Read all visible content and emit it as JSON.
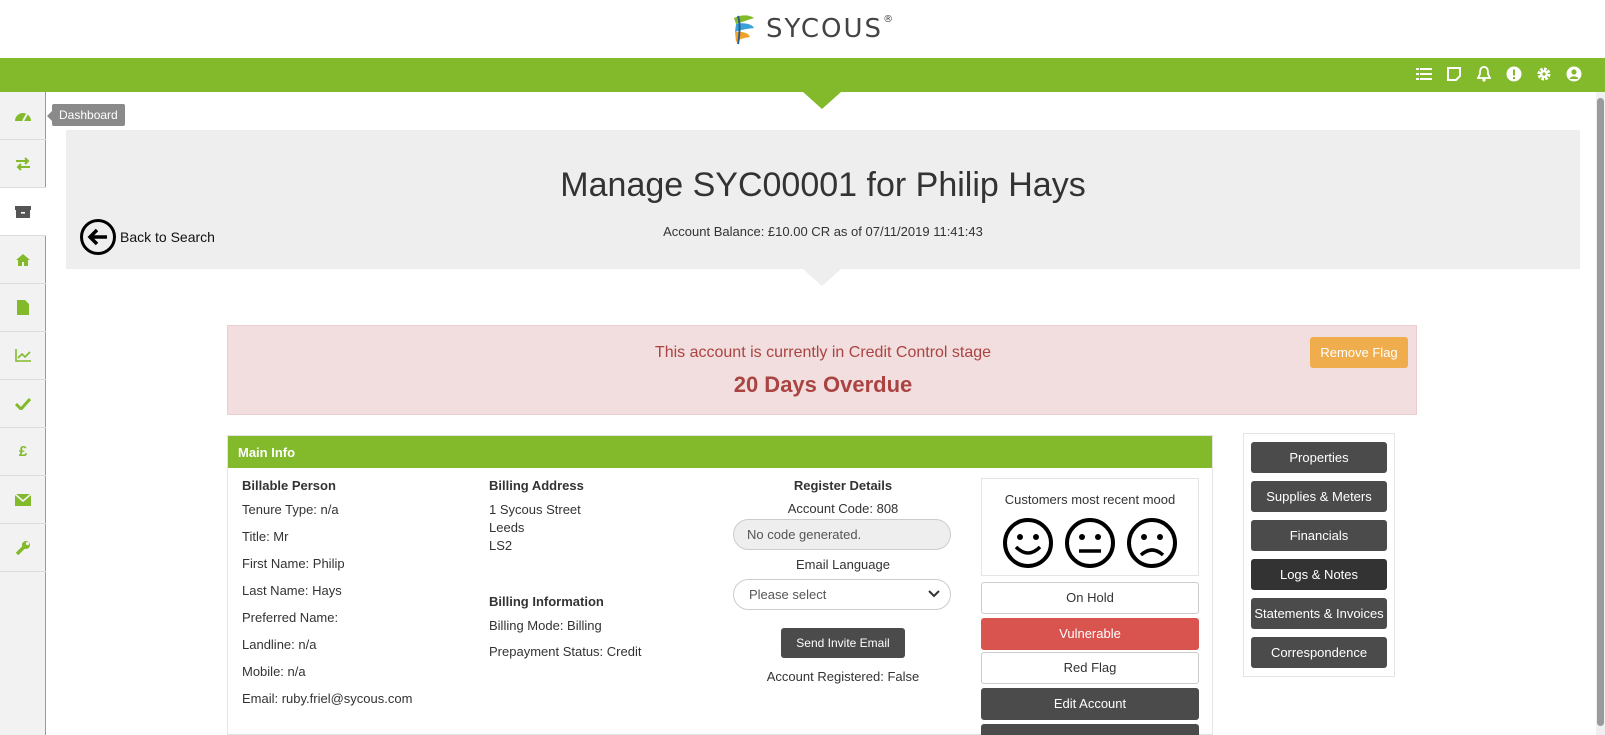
{
  "brand": {
    "name": "SYCOUS",
    "mark": "®",
    "green": "#83ba2b"
  },
  "top_icons": [
    "list-icon",
    "note-icon",
    "bell-icon",
    "alert-icon",
    "gear-icon",
    "user-icon"
  ],
  "sidebar": {
    "items": [
      {
        "icon": "dashboard-icon"
      },
      {
        "icon": "transfer-icon"
      },
      {
        "icon": "archive-icon"
      },
      {
        "icon": "home-icon"
      },
      {
        "icon": "document-icon"
      },
      {
        "icon": "chart-icon"
      },
      {
        "icon": "check-icon"
      },
      {
        "icon": "pound-icon",
        "glyph": "£"
      },
      {
        "icon": "mail-icon"
      },
      {
        "icon": "wrench-icon"
      }
    ],
    "tooltip": "Dashboard"
  },
  "header": {
    "title": "Manage SYC00001 for Philip Hays",
    "balance": "Account Balance: £10.00 CR as of 07/11/2019 11:41:43",
    "back_label": "Back to Search"
  },
  "alert": {
    "message": "This account is currently in Credit Control stage",
    "status": "20 Days Overdue",
    "button": "Remove Flag"
  },
  "main_info": {
    "heading": "Main Info",
    "billable": {
      "heading": "Billable Person",
      "rows": [
        "Tenure Type: n/a",
        "Title: Mr",
        "First Name: Philip",
        "Last Name: Hays",
        "Preferred Name:",
        "Landline: n/a",
        "Mobile: n/a",
        "Email: ruby.friel@sycous.com"
      ]
    },
    "billing_address": {
      "heading": "Billing Address",
      "lines": [
        "1 Sycous Street",
        "Leeds",
        "LS2"
      ]
    },
    "billing_information": {
      "heading": "Billing Information",
      "mode": "Billing Mode: Billing",
      "prepayment": "Prepayment Status: Credit"
    },
    "register": {
      "heading": "Register Details",
      "account_code": "Account Code: 808",
      "code_status": "No code generated.",
      "email_language_label": "Email Language",
      "email_language_value": "Please select",
      "send_button": "Send Invite Email",
      "registered": "Account Registered: False"
    },
    "mood": {
      "title": "Customers most recent mood"
    },
    "buttons": {
      "on_hold": "On Hold",
      "vulnerable": "Vulnerable",
      "red_flag": "Red Flag",
      "edit_account": "Edit Account"
    }
  },
  "right_nav": {
    "items": [
      "Properties",
      "Supplies & Meters",
      "Financials",
      "Logs & Notes",
      "Statements & Invoices",
      "Correspondence"
    ]
  }
}
